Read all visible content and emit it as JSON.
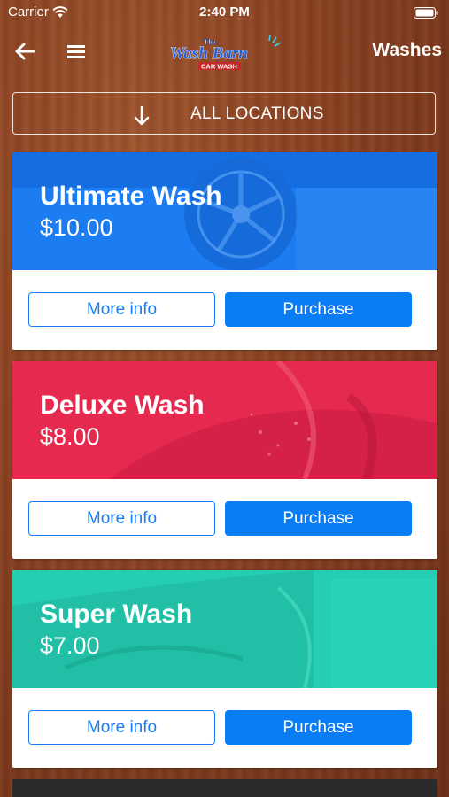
{
  "status_bar": {
    "carrier": "Carrier",
    "time": "2:40 PM"
  },
  "nav": {
    "title": "Washes",
    "logo_text": "The Wash Barn Car Wash"
  },
  "locations": {
    "label": "ALL LOCATIONS"
  },
  "washes": [
    {
      "name": "Ultimate Wash",
      "price": "$10.00",
      "color": "#1c7cf2",
      "more_info": "More info",
      "purchase": "Purchase"
    },
    {
      "name": "Deluxe Wash",
      "price": "$8.00",
      "color": "#e5294f",
      "more_info": "More info",
      "purchase": "Purchase"
    },
    {
      "name": "Super Wash",
      "price": "$7.00",
      "color": "#25cdb2",
      "more_info": "More info",
      "purchase": "Purchase"
    }
  ],
  "icons": {
    "back": "arrow-left-icon",
    "menu": "hamburger-menu-icon",
    "locations": "arrow-down-icon",
    "wifi": "wifi-icon",
    "battery": "battery-icon"
  }
}
